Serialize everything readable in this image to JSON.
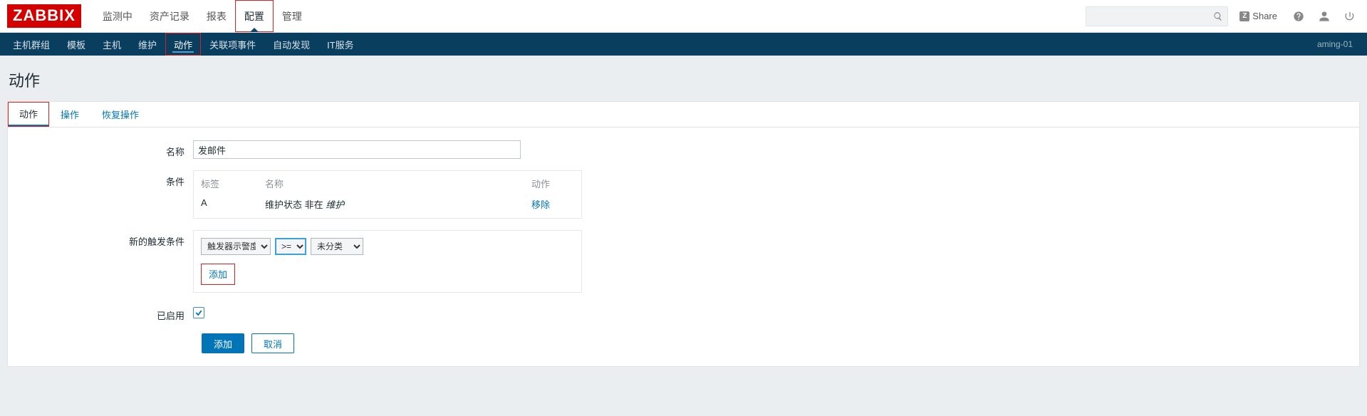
{
  "brand": "ZABBIX",
  "main_nav": {
    "items": [
      "监测中",
      "资产记录",
      "报表",
      "配置",
      "管理"
    ],
    "active_index": 3
  },
  "top_right": {
    "search_placeholder": "",
    "share_label": "Share"
  },
  "sub_nav": {
    "items": [
      "主机群组",
      "模板",
      "主机",
      "维护",
      "动作",
      "关联项事件",
      "自动发现",
      "IT服务"
    ],
    "active_index": 4,
    "hostname": "aming-01"
  },
  "page_title": "动作",
  "tabs": {
    "items": [
      "动作",
      "操作",
      "恢复操作"
    ],
    "active_index": 0
  },
  "form": {
    "name_label": "名称",
    "name_value": "发邮件",
    "conditions_label": "条件",
    "conditions_header": {
      "tag": "标签",
      "name": "名称",
      "action": "动作"
    },
    "conditions_rows": [
      {
        "tag": "A",
        "name_prefix": "维护状态 非在 ",
        "name_italic": "维护",
        "action": "移除"
      }
    ],
    "new_condition_label": "新的触发条件",
    "new_condition": {
      "field_options": [
        "触发器示警度"
      ],
      "field_value": "触发器示警度",
      "operator_options": [
        ">="
      ],
      "operator_value": ">=",
      "value_options": [
        "未分类"
      ],
      "value_value": "未分类",
      "add_link": "添加"
    },
    "enabled_label": "已启用",
    "enabled_checked": true,
    "submit_label": "添加",
    "cancel_label": "取消"
  }
}
